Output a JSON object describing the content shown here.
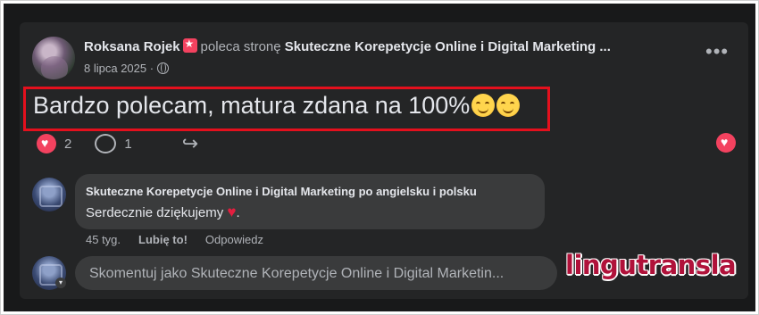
{
  "post": {
    "author": "Roksana Rojek",
    "recommends_text": "poleca stronę",
    "page_name": "Skuteczne Korepetycje Online i Digital Marketing ...",
    "date": "8 lipca 2025 ·",
    "audience_icon": "globe-icon",
    "more_icon": "•••",
    "text": "Bardzo polecam, matura zdana na 100%",
    "reactions_count": "2",
    "comments_count": "1",
    "highlight_color": "#e4101d"
  },
  "reply": {
    "author": "Skuteczne Korepetycje Online i Digital Marketing po angielsku i polsku",
    "text": "Serdecznie dziękujemy",
    "heart": "♥",
    "time": "45 tyg.",
    "like_label": "Lubię to!",
    "reply_label": "Odpowiedz"
  },
  "composer": {
    "placeholder": "Skomentuj jako Skuteczne Korepetycje Online i Digital Marketin..."
  },
  "watermark": "lingutransla",
  "colors": {
    "background": "#18191a",
    "card": "#242526",
    "bubble": "#3a3b3c",
    "reaction": "#f3425f",
    "watermark": "#b0123a"
  }
}
